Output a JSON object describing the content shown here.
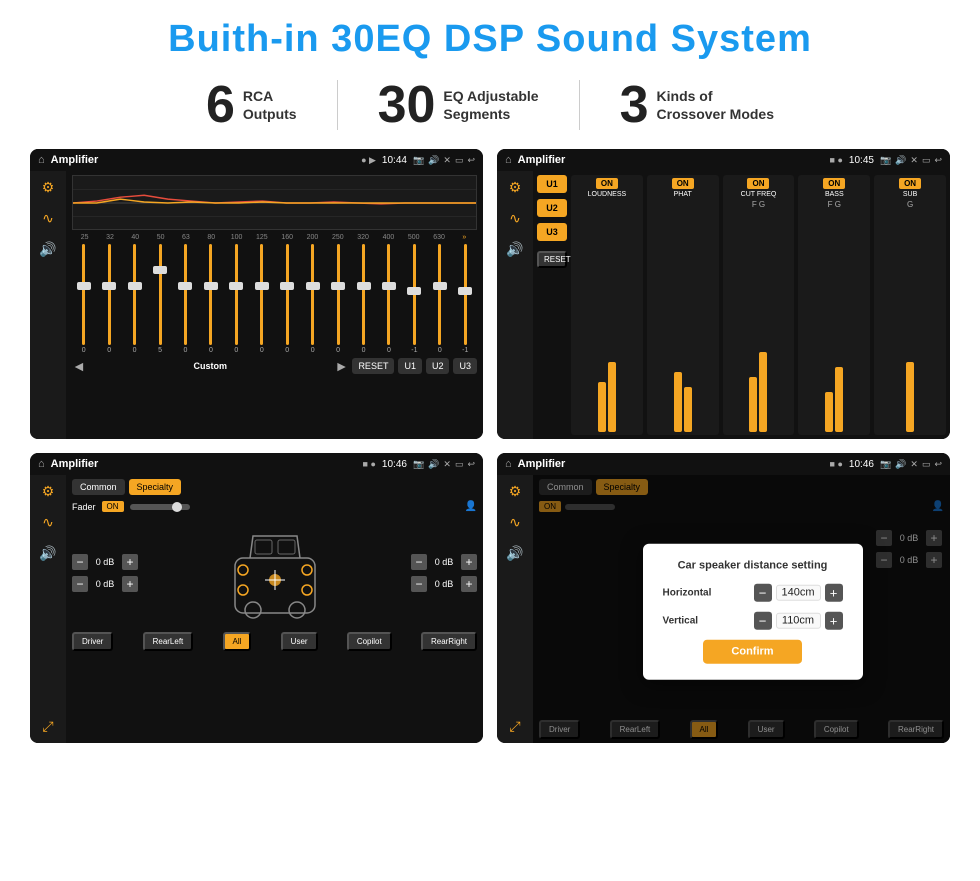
{
  "title": "Buith-in 30EQ DSP Sound System",
  "stats": [
    {
      "number": "6",
      "label_line1": "RCA",
      "label_line2": "Outputs"
    },
    {
      "number": "30",
      "label_line1": "EQ Adjustable",
      "label_line2": "Segments"
    },
    {
      "number": "3",
      "label_line1": "Kinds of",
      "label_line2": "Crossover Modes"
    }
  ],
  "screen1": {
    "topbar_title": "Amplifier",
    "time": "10:44",
    "eq_freqs": [
      "25",
      "32",
      "40",
      "50",
      "63",
      "80",
      "100",
      "125",
      "160",
      "200",
      "250",
      "320",
      "400",
      "500",
      "630"
    ],
    "eq_values": [
      "0",
      "0",
      "0",
      "5",
      "0",
      "0",
      "0",
      "0",
      "0",
      "0",
      "0",
      "0",
      "0",
      "-1",
      "0",
      "-1"
    ],
    "buttons": [
      "Custom",
      "RESET",
      "U1",
      "U2",
      "U3"
    ]
  },
  "screen2": {
    "topbar_title": "Amplifier",
    "time": "10:45",
    "u_buttons": [
      "U1",
      "U2",
      "U3"
    ],
    "modules": [
      {
        "on": true,
        "title": "LOUDNESS"
      },
      {
        "on": true,
        "title": "PHAT"
      },
      {
        "on": true,
        "title": "CUT FREQ"
      },
      {
        "on": true,
        "title": "BASS"
      },
      {
        "on": true,
        "title": "SUB"
      }
    ],
    "reset_label": "RESET"
  },
  "screen3": {
    "topbar_title": "Amplifier",
    "time": "10:46",
    "tabs": [
      "Common",
      "Specialty"
    ],
    "fader_label": "Fader",
    "fader_on": "ON",
    "db_values_left": [
      "0 dB",
      "0 dB"
    ],
    "db_values_right": [
      "0 dB",
      "0 dB"
    ],
    "bottom_buttons": [
      "Driver",
      "RearLeft",
      "All",
      "User",
      "Copilot",
      "RearRight"
    ]
  },
  "screen4": {
    "topbar_title": "Amplifier",
    "time": "10:46",
    "tabs": [
      "Common",
      "Specialty"
    ],
    "fader_on": "ON",
    "db_values_right": [
      "0 dB",
      "0 dB"
    ],
    "dialog": {
      "title": "Car speaker distance setting",
      "horizontal_label": "Horizontal",
      "horizontal_value": "140cm",
      "vertical_label": "Vertical",
      "vertical_value": "110cm",
      "confirm_label": "Confirm"
    },
    "bottom_buttons": [
      "Driver",
      "RearLeft",
      "All",
      "User",
      "Copilot",
      "RearRight"
    ]
  },
  "icons": {
    "home": "⌂",
    "tune": "≡",
    "wave": "∿",
    "speaker": "🔊",
    "arrow_left": "◄",
    "arrow_right": "►",
    "minus": "−",
    "plus": "+",
    "person": "👤"
  },
  "colors": {
    "accent": "#f5a623",
    "dark_bg": "#1a1a1a",
    "screen_bg": "#111",
    "blue": "#1a9aef"
  }
}
